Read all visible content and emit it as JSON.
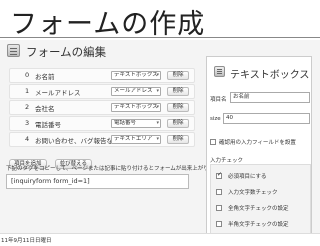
{
  "slide": {
    "title": "フォームの作成",
    "date": "11年9月11日日曜日"
  },
  "page": {
    "title": "フォームの編集",
    "fields": [
      {
        "index": "0",
        "name": "お名前",
        "type": "テキストボックス",
        "delete": "削除"
      },
      {
        "index": "1",
        "name": "メールアドレス",
        "type": "メールアドレス",
        "delete": "削除"
      },
      {
        "index": "2",
        "name": "会社名",
        "type": "テキストボックス",
        "delete": "削除"
      },
      {
        "index": "3",
        "name": "電話番号",
        "type": "電話番号",
        "delete": "削除"
      },
      {
        "index": "4",
        "name": "お問い合わせ、バグ報告など",
        "type": "テキストエリア",
        "delete": "削除"
      }
    ],
    "add_button": "項目を追加",
    "sort_button": "並び替える",
    "note": "下記のタグをコピーして、ページまたは記事に貼り付けるとフォームが出来上がります。",
    "shortcode": "[inquiryform form_id=1]"
  },
  "panel": {
    "title": "テキストボックス",
    "item_name_label": "項目名",
    "item_name_value": "お名前",
    "size_label": "size",
    "size_value": "40",
    "confirm_label": "確認用の入力フィールドを設置",
    "input_check_label": "入力チェック",
    "checks": [
      {
        "label": "必須項目にする",
        "checked": true
      },
      {
        "label": "入力文字数チェック",
        "checked": false
      },
      {
        "label": "全角文字チェックの設定",
        "checked": false
      },
      {
        "label": "半角文字チェックの設定",
        "checked": false
      }
    ],
    "bottom_text": "入力チェックエラーメッセージ（Option）を設置"
  }
}
